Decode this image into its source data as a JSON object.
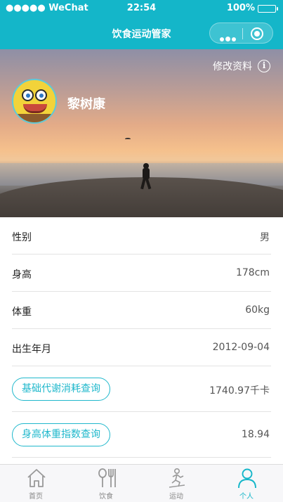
{
  "status_bar": {
    "carrier": "●●●●● WeChat",
    "time": "22:54",
    "battery": "100%"
  },
  "nav": {
    "title": "饮食运动管家"
  },
  "profile": {
    "edit_label": "修改资料",
    "name": "黎树康"
  },
  "rows": [
    {
      "label": "性别",
      "value": "男"
    },
    {
      "label": "身高",
      "value": "178cm"
    },
    {
      "label": "体重",
      "value": "60kg"
    },
    {
      "label": "出生年月",
      "value": "2012-09-04"
    }
  ],
  "queries": [
    {
      "button": "基础代谢消耗查询",
      "value": "1740.97千卡"
    },
    {
      "button": "身高体重指数查询",
      "value": "18.94"
    }
  ],
  "tabs": [
    {
      "label": "首页",
      "icon": "home-icon"
    },
    {
      "label": "饮食",
      "icon": "cutlery-icon"
    },
    {
      "label": "运动",
      "icon": "running-icon"
    },
    {
      "label": "个人",
      "icon": "person-icon"
    }
  ],
  "colors": {
    "accent": "#14b6c9",
    "tab_inactive": "#888888"
  }
}
